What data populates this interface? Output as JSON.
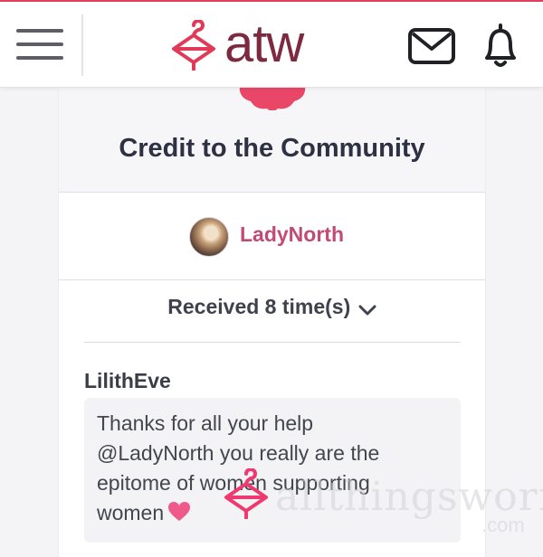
{
  "header": {
    "logo_text": "atw",
    "icons": [
      "menu-icon",
      "hanger-logo-icon",
      "mail-icon",
      "bell-icon"
    ]
  },
  "card": {
    "title": "Credit to the Community",
    "author": "LadyNorth",
    "received": "Received 8 time(s)"
  },
  "comment": {
    "author": "LilithEve",
    "lines": [
      "Thanks for all your help",
      "@LadyNorth you really are the",
      "epitome of women supporting",
      "women"
    ],
    "emoji": "heart"
  },
  "watermark": {
    "text": "allthingsworn",
    "suffix": ".com"
  },
  "colors": {
    "accent": "#e0405e",
    "brand": "#7d2a40",
    "link": "#c24b72"
  }
}
